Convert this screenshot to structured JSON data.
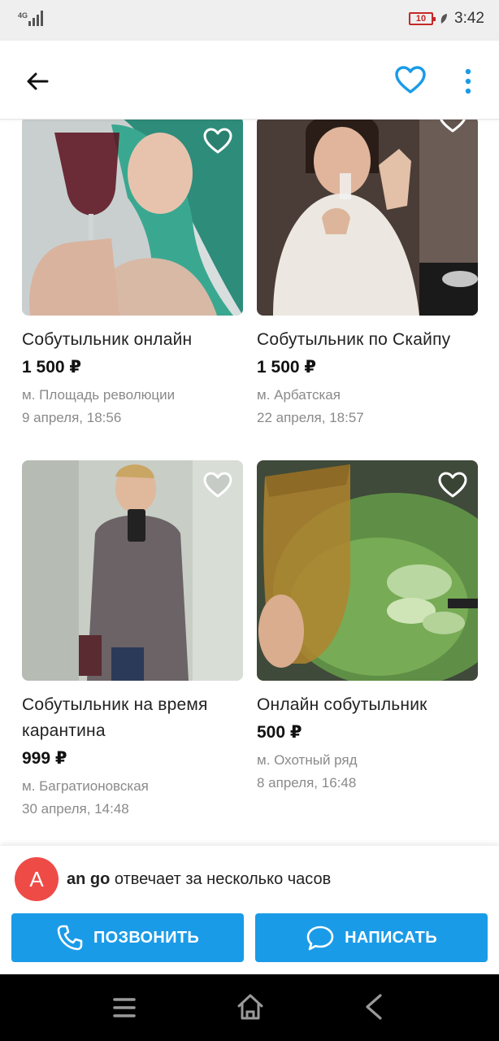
{
  "status_bar": {
    "network": "4G",
    "battery": "10",
    "time": "3:42"
  },
  "top_bar": {
    "back_icon": "arrow-left-icon",
    "favorite_icon": "heart-outline-icon",
    "menu_icon": "more-vertical-icon"
  },
  "listings": [
    {
      "title": "Собутыльник онлайн",
      "price": "1 500 ₽",
      "metro": "м. Площадь революции",
      "date": "9 апреля, 18:56"
    },
    {
      "title": "Собутыльник по Скайпу",
      "price": "1 500 ₽",
      "metro": "м. Арбатская",
      "date": "22 апреля, 18:57"
    },
    {
      "title": "Собутыльник на время карантина",
      "price": "999 ₽",
      "metro": "м. Багратионовская",
      "date": "30 апреля, 14:48"
    },
    {
      "title": "Онлайн собутыльник",
      "price": "500 ₽",
      "metro": "м. Охотный ряд",
      "date": "8 апреля, 16:48"
    }
  ],
  "seller": {
    "avatar_letter": "A",
    "name": "an go",
    "response": " отвечает за несколько часов"
  },
  "actions": {
    "call_label": "ПОЗВОНИТЬ",
    "write_label": "НАПИСАТЬ"
  },
  "colors": {
    "accent": "#1a9be8",
    "avatar": "#ee4b47",
    "muted_text": "#8a8a8a"
  }
}
